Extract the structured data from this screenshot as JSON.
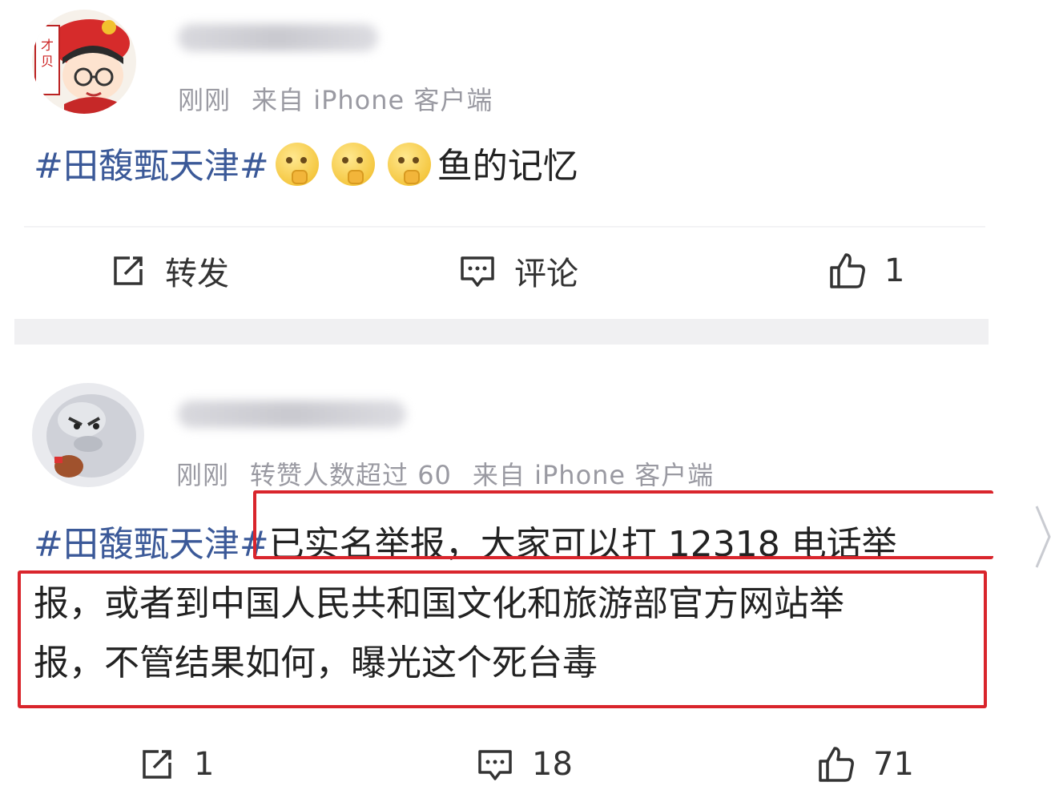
{
  "posts": [
    {
      "time": "刚刚",
      "source": "来自 iPhone 客户端",
      "topic": "#田馥甄天津#",
      "text_after": "鱼的记忆",
      "emojis": [
        "thinking-emoji",
        "thinking-emoji",
        "thinking-emoji"
      ],
      "actions": {
        "repost_label": "转发",
        "comment_label": "评论",
        "like_count": "1"
      }
    },
    {
      "time": "刚刚",
      "repost_note": "转赞人数超过 60",
      "source": "来自 iPhone 客户端",
      "topic": "#田馥甄天津#",
      "line1_rest": "已实名举报，大家可以打 12318 电话举",
      "line2": "报，或者到中国人民共和国文化和旅游部官方网站举",
      "line3": "报，不管结果如何，曝光这个死台毒",
      "actions": {
        "repost_count": "1",
        "comment_count": "18",
        "like_count": "71"
      }
    }
  ],
  "colors": {
    "topic": "#3b5998",
    "highlight_box": "#d9252c",
    "meta_text": "#9a9aa2"
  },
  "icons": [
    "repost-icon",
    "comment-icon",
    "thumbs-up-icon",
    "chevron-right-icon"
  ]
}
